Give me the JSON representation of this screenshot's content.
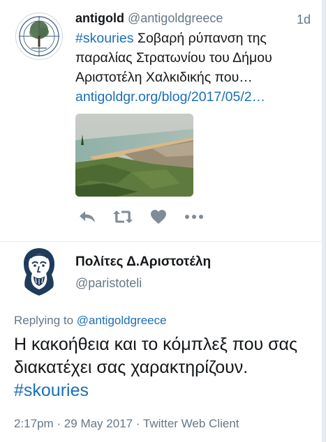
{
  "tweet1": {
    "display_name": "antigold",
    "handle": "@antigoldgreece",
    "age": "1d",
    "hashtag": "#skouries",
    "text_body": " Σοβαρή ρύπανση της παραλίας Στρατωνίου του Δήμου Αριστοτέλη Χαλκιδικής που…",
    "link": "antigoldgr.org/blog/2017/05/2…",
    "actions": [
      "reply",
      "retweet",
      "like",
      "more"
    ]
  },
  "tweet2": {
    "display_name": "Πολίτες Δ.Αριστοτέλη",
    "handle": "@paristoteli",
    "replying_prefix": "Replying to ",
    "replying_to": "@antigoldgreece",
    "text_body": "Η κακοήθεια και το κόμπλεξ που σας διακατέχει σας χαρακτηρίζουν. ",
    "hashtag": "#skouries",
    "meta": "2:17pm · 29 May 2017 · Twitter Web Client"
  },
  "colors": {
    "link": "#1b6fb8",
    "secondary_text": "#657786",
    "icon": "#7f8c96"
  }
}
